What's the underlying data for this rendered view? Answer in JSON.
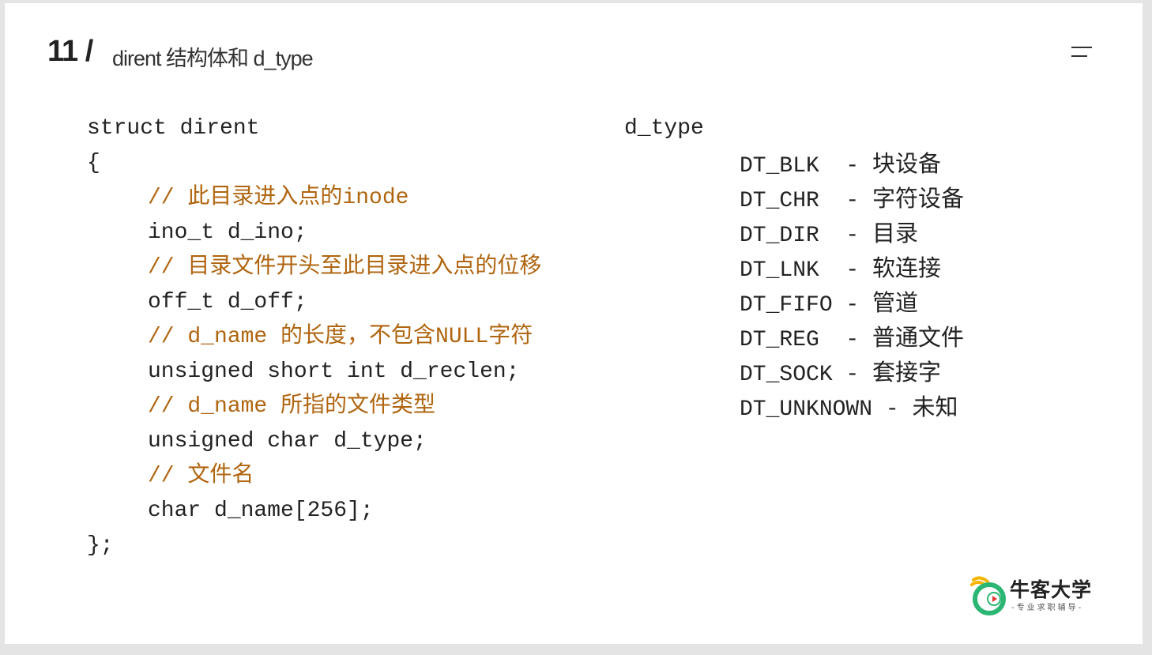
{
  "header": {
    "number": "11 /",
    "title": "dirent 结构体和 d_type"
  },
  "code": {
    "lines": [
      {
        "text": "struct dirent",
        "type": "code",
        "indent": false
      },
      {
        "text": "{",
        "type": "code",
        "indent": false
      },
      {
        "text": "// 此目录进入点的inode",
        "type": "comment",
        "indent": true
      },
      {
        "text": "ino_t d_ino;",
        "type": "code",
        "indent": true
      },
      {
        "text": "// 目录文件开头至此目录进入点的位移",
        "type": "comment",
        "indent": true
      },
      {
        "text": "off_t d_off;",
        "type": "code",
        "indent": true
      },
      {
        "text": "// d_name 的长度，不包含NULL字符",
        "type": "comment",
        "indent": true
      },
      {
        "text": "unsigned short int d_reclen;",
        "type": "code",
        "indent": true
      },
      {
        "text": "// d_name 所指的文件类型",
        "type": "comment",
        "indent": true
      },
      {
        "text": "unsigned char d_type;",
        "type": "code",
        "indent": true
      },
      {
        "text": "// 文件名",
        "type": "comment",
        "indent": true
      },
      {
        "text": "char d_name[256];",
        "type": "code",
        "indent": true
      },
      {
        "text": "};",
        "type": "code",
        "indent": false
      }
    ]
  },
  "dtype": {
    "heading": "d_type",
    "items": [
      {
        "name": "DT_BLK  - ",
        "desc": "块设备"
      },
      {
        "name": "DT_CHR  - ",
        "desc": "字符设备"
      },
      {
        "name": "DT_DIR  - ",
        "desc": "目录"
      },
      {
        "name": "DT_LNK  - ",
        "desc": "软连接"
      },
      {
        "name": "DT_FIFO - ",
        "desc": "管道"
      },
      {
        "name": "DT_REG  - ",
        "desc": "普通文件"
      },
      {
        "name": "DT_SOCK - ",
        "desc": "套接字"
      },
      {
        "name": "DT_UNKNOWN - ",
        "desc": "未知"
      }
    ]
  },
  "logo": {
    "name": "牛客大学",
    "tagline": "-专业求职辅导-"
  },
  "colors": {
    "comment": "#b0650f",
    "code": "#222222",
    "logo_green": "#2bb673",
    "logo_yellow": "#f5b400"
  }
}
